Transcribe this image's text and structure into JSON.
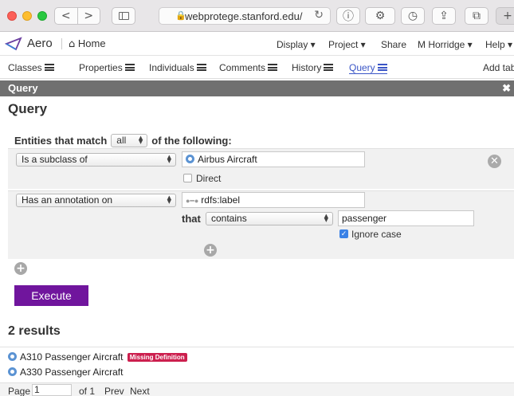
{
  "browser": {
    "url": "webprotege.stanford.edu/",
    "back_glyph": "<",
    "forward_glyph": ">"
  },
  "appbar": {
    "app_name": "Aero",
    "home_label": "Home",
    "menus": [
      "Display ▾",
      "Project ▾",
      "Share",
      "M Horridge ▾",
      "Help ▾"
    ]
  },
  "tabs": [
    "Classes",
    "Properties",
    "Individuals",
    "Comments",
    "History",
    "Query",
    "Add tab"
  ],
  "active_tab": "Query",
  "portlet": {
    "header": "Query",
    "close_glyph": "✖",
    "title": "Query"
  },
  "query": {
    "match_prefix": "Entities that match",
    "match_value": "all",
    "match_suffix": "of the following:",
    "criteria": [
      {
        "type": "Is a subclass of",
        "value": "Airbus Aircraft",
        "direct_label": "Direct",
        "direct_checked": false
      },
      {
        "type": "Has an annotation on",
        "property": "rdfs:label",
        "that_label": "that",
        "operator": "contains",
        "text": "passenger",
        "ignore_case_label": "Ignore case",
        "ignore_case_checked": true
      }
    ],
    "execute_label": "Execute"
  },
  "results": {
    "heading": "2 results",
    "items": [
      {
        "label": "A310 Passenger Aircraft",
        "badge": "Missing Definition"
      },
      {
        "label": "A330 Passenger Aircraft",
        "badge": ""
      }
    ]
  },
  "pager": {
    "page_label": "Page",
    "page_value": "1",
    "of_label": "of 1",
    "prev_label": "Prev",
    "next_label": "Next"
  },
  "colors": {
    "accent": "#70159d",
    "active_tab": "#3a55c6",
    "badge": "#cc1f4e",
    "portlet_header": "#707070"
  }
}
